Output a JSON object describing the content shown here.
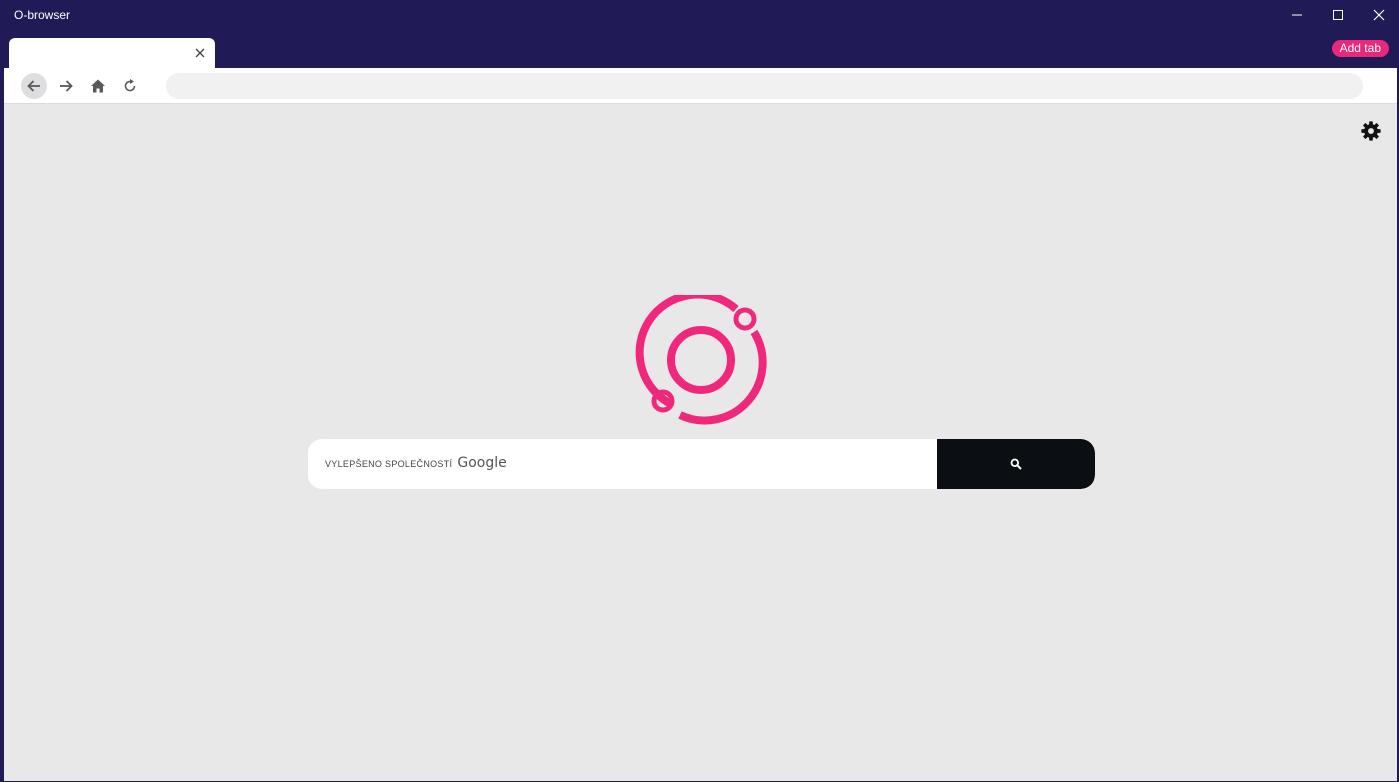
{
  "window": {
    "title": "O-browser",
    "controls": [
      "minimize-icon",
      "maximize-icon",
      "close-icon"
    ]
  },
  "tabs": {
    "items": [
      {
        "label": "",
        "close_icon": "close-icon"
      }
    ],
    "add_tab_label": "Add tab"
  },
  "navbar": {
    "buttons": [
      "back-arrow-icon",
      "forward-arrow-icon",
      "home-icon",
      "reload-icon"
    ],
    "address_value": "",
    "address_placeholder": ""
  },
  "content": {
    "settings_icon": "gear-icon",
    "logo": "o-browser-logo",
    "search": {
      "enhanced_by": "VYLEPŠENO SPOLEČNOSTÍ",
      "provider": "Google",
      "value": "",
      "button_icon": "search-icon"
    }
  },
  "colors": {
    "titlebar_bg": "#201a56",
    "accent": "#e8287a",
    "content_bg": "#e8e8e8",
    "search_button_bg": "#0b0f14"
  }
}
